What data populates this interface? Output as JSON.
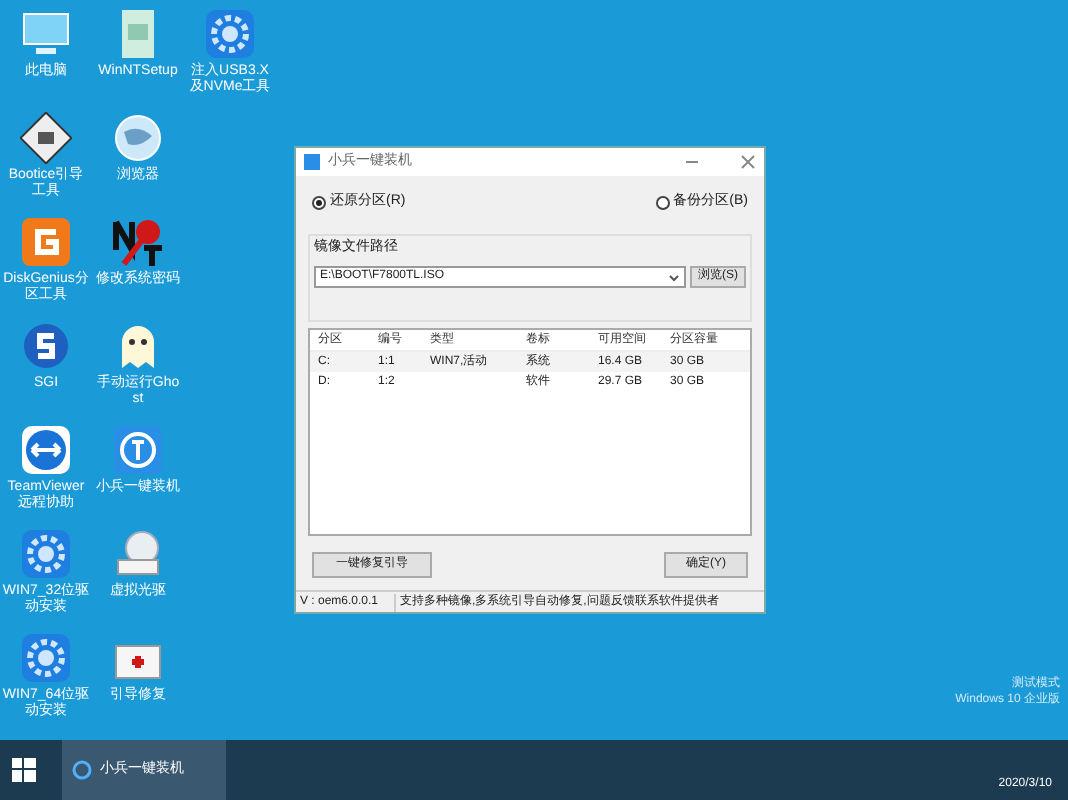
{
  "desktop_icons": [
    [
      {
        "label": "此电脑",
        "kind": "pc"
      },
      {
        "label": "WinNTSetup",
        "kind": "file"
      },
      {
        "label": "注入USB3.X及NVMe工具",
        "kind": "gear"
      }
    ],
    [
      {
        "label": "Bootice引导工具",
        "kind": "disk"
      },
      {
        "label": "浏览器",
        "kind": "globe"
      }
    ],
    [
      {
        "label": "DiskGenius分区工具",
        "kind": "dg"
      },
      {
        "label": "修改系统密码",
        "kind": "nt"
      }
    ],
    [
      {
        "label": "SGI",
        "kind": "sgi"
      },
      {
        "label": "手动运行Ghost",
        "kind": "ghost"
      }
    ],
    [
      {
        "label": "TeamViewer远程协助",
        "kind": "tv"
      },
      {
        "label": "小兵一键装机",
        "kind": "app"
      }
    ],
    [
      {
        "label": "WIN7_32位驱动安装",
        "kind": "gear"
      },
      {
        "label": "虚拟光驱",
        "kind": "cd"
      }
    ],
    [
      {
        "label": "WIN7_64位驱动安装",
        "kind": "gear"
      },
      {
        "label": "引导修复",
        "kind": "kit"
      }
    ]
  ],
  "window": {
    "title": "小兵一键装机",
    "radios": [
      {
        "label": "还原分区(R)",
        "selected": true
      },
      {
        "label": "备份分区(B)",
        "selected": false
      }
    ],
    "path_label": "镜像文件路径",
    "path_value": "E:\\BOOT\\F7800TL.ISO",
    "browse": "浏览(S)",
    "table": {
      "columns": [
        "分区",
        "编号",
        "类型",
        "卷标",
        "可用空间",
        "分区容量"
      ],
      "rows": [
        [
          "C:",
          "1:1",
          "WIN7,活动",
          "系统",
          "16.4 GB",
          "30 GB"
        ],
        [
          "D:",
          "1:2",
          "",
          "软件",
          "29.7 GB",
          "30 GB"
        ]
      ]
    },
    "buttons": [
      "一键修复引导",
      "确定(Y)"
    ],
    "status_bar": [
      "V : oem6.0.0.1",
      "支持多种镜像,多系统引导自动修复,问题反馈联系软件提供者"
    ]
  },
  "watermark_text": [
    "测试模式",
    "Windows 10 企业版"
  ],
  "taskbar": {
    "apps": [
      {
        "label": "小兵一键装机",
        "selected": true
      }
    ],
    "date": "2020/3/10"
  }
}
